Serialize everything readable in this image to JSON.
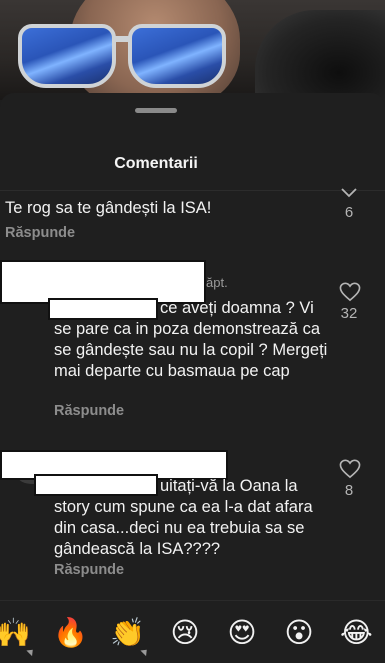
{
  "sheet": {
    "title": "Comentarii"
  },
  "comments": [
    {
      "text": "Te rog sa te gândești la ISA!",
      "reply": "Răspunde",
      "likes": "6"
    },
    {
      "time_fragment": "ăpt.",
      "text_line1": "ce aveți doamna ? Vi",
      "text_rest": "se pare ca in poza demonstrează ca se gândește sau nu la copil ? Mergeți  mai departe cu basmaua pe cap",
      "reply": "Răspunde",
      "likes": "32"
    },
    {
      "text_line1": "uitați-vă la Oana la",
      "text_rest": "story cum spune ca ea l-a dat afara din casa...deci nu ea trebuia sa se gândească la ISA????",
      "reply": "Răspunde",
      "likes": "8"
    }
  ],
  "emoji_bar": {
    "items": [
      {
        "name": "raising-hands-icon",
        "glyph": "🙌"
      },
      {
        "name": "fire-icon",
        "glyph": "🔥"
      },
      {
        "name": "clapping-hands-icon",
        "glyph": "👏"
      },
      {
        "name": "crying-face-icon",
        "glyph": "😢"
      },
      {
        "name": "heart-eyes-icon",
        "glyph": "😍"
      },
      {
        "name": "surprised-face-icon",
        "glyph": "😮"
      },
      {
        "name": "tears-of-joy-icon",
        "glyph": "😂"
      }
    ]
  },
  "colors": {
    "background": "#1f1f1f",
    "text": "#f2f2f2",
    "muted": "#8c8c8c",
    "redaction": "#ffffff"
  }
}
